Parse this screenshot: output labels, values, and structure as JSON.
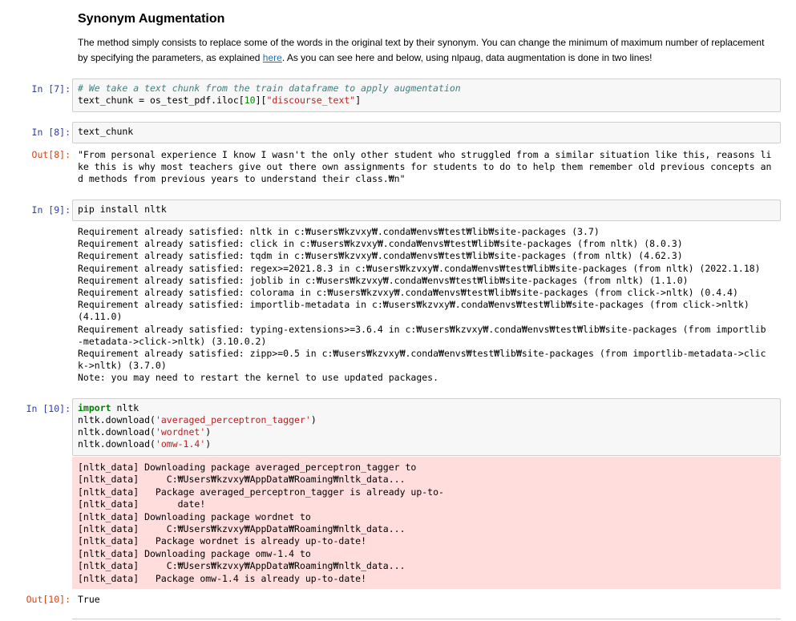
{
  "markdown": {
    "title": "Synonym Augmentation",
    "paragraph_before_link": "The method simply consists to replace some of the words in the original text by their synonym. You can change the minimum of maximum number of replacement by specifying the parameters, as explained ",
    "link_text": "here",
    "paragraph_after_link": ". As you can see here and below, using nlpaug, data augmentation is done in two lines!"
  },
  "cells": {
    "c7": {
      "prompt": "In [7]:",
      "comment": "# We take a text chunk from the train dataframe to apply augmentation",
      "code_var": "text_chunk = os_test_pdf.iloc[",
      "code_num": "10",
      "code_mid": "][",
      "code_str": "\"discourse_text\"",
      "code_end": "]"
    },
    "c8": {
      "prompt": "In [8]:",
      "code": "text_chunk",
      "out_prompt": "Out[8]:",
      "output": "\"From personal experience I know I wasn't the only other student who struggled from a similar situation like this, reasons like this is why most teachers give out there own assignments for students to do to help them remember old previous concepts and methods from previous years to understand their class.₩n\""
    },
    "c9": {
      "prompt": "In [9]:",
      "code": "pip install nltk",
      "output": "Requirement already satisfied: nltk in c:₩users₩kzvxy₩.conda₩envs₩test₩lib₩site-packages (3.7)\nRequirement already satisfied: click in c:₩users₩kzvxy₩.conda₩envs₩test₩lib₩site-packages (from nltk) (8.0.3)\nRequirement already satisfied: tqdm in c:₩users₩kzvxy₩.conda₩envs₩test₩lib₩site-packages (from nltk) (4.62.3)\nRequirement already satisfied: regex>=2021.8.3 in c:₩users₩kzvxy₩.conda₩envs₩test₩lib₩site-packages (from nltk) (2022.1.18)\nRequirement already satisfied: joblib in c:₩users₩kzvxy₩.conda₩envs₩test₩lib₩site-packages (from nltk) (1.1.0)\nRequirement already satisfied: colorama in c:₩users₩kzvxy₩.conda₩envs₩test₩lib₩site-packages (from click->nltk) (0.4.4)\nRequirement already satisfied: importlib-metadata in c:₩users₩kzvxy₩.conda₩envs₩test₩lib₩site-packages (from click->nltk)\n(4.11.0)\nRequirement already satisfied: typing-extensions>=3.6.4 in c:₩users₩kzvxy₩.conda₩envs₩test₩lib₩site-packages (from importlib\n-metadata->click->nltk) (3.10.0.2)\nRequirement already satisfied: zipp>=0.5 in c:₩users₩kzvxy₩.conda₩envs₩test₩lib₩site-packages (from importlib-metadata->clic\nk->nltk) (3.7.0)\nNote: you may need to restart the kernel to use updated packages."
    },
    "c10": {
      "prompt": "In [10]:",
      "kw_import": "import",
      "import_rest": " nltk",
      "dl_prefix": "nltk.download(",
      "dl_suffix": ")",
      "dl1": "'averaged_perceptron_tagger'",
      "dl2": "'wordnet'",
      "dl3": "'omw-1.4'",
      "stderr": "[nltk_data] Downloading package averaged_perceptron_tagger to\n[nltk_data]     C:₩Users₩kzvxy₩AppData₩Roaming₩nltk_data...\n[nltk_data]   Package averaged_perceptron_tagger is already up-to-\n[nltk_data]       date!\n[nltk_data] Downloading package wordnet to\n[nltk_data]     C:₩Users₩kzvxy₩AppData₩Roaming₩nltk_data...\n[nltk_data]   Package wordnet is already up-to-date!\n[nltk_data] Downloading package omw-1.4 to\n[nltk_data]     C:₩Users₩kzvxy₩AppData₩Roaming₩nltk_data...\n[nltk_data]   Package omw-1.4 is already up-to-date!",
      "out_prompt": "Out[10]:",
      "output": "True"
    }
  }
}
